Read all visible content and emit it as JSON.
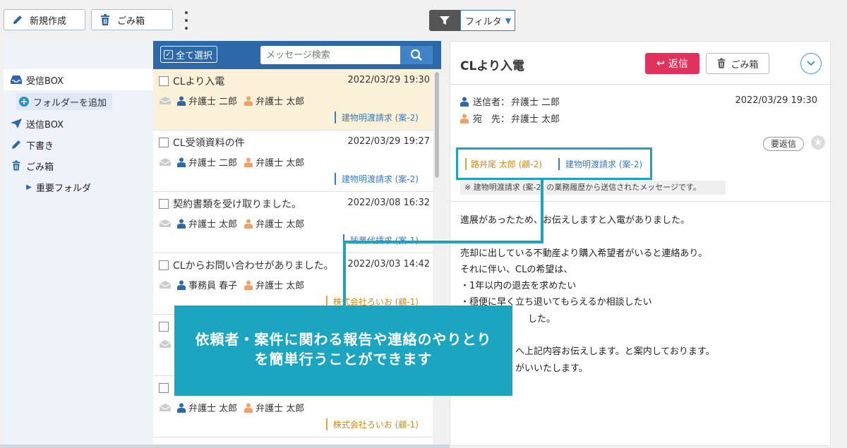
{
  "toolbar": {
    "new_label": "新規作成",
    "trash_label": "ごみ箱",
    "filter_label": "フィルタ"
  },
  "sidebar": {
    "items": [
      {
        "label": "受信BOX",
        "icon": "inbox-icon"
      },
      {
        "label": "フォルダーを追加",
        "icon": "plus-circle-icon"
      },
      {
        "label": "送信BOX",
        "icon": "send-icon"
      },
      {
        "label": "下書き",
        "icon": "pencil-icon"
      },
      {
        "label": "ごみ箱",
        "icon": "trash-icon"
      },
      {
        "label": "重要フォルダ",
        "icon": "caret-right-icon"
      }
    ]
  },
  "list": {
    "select_all_label": "全て選択",
    "search_placeholder": "メッセージ検索",
    "messages": [
      {
        "subject": "CLより入電",
        "date": "2022/03/29 19:30",
        "from": "弁護士 二郎",
        "to": "弁護士 太郎",
        "tag": "建物明渡請求 (案-2)",
        "tag_color": "blue",
        "selected": true
      },
      {
        "subject": "CL受領資料の件",
        "date": "2022/03/29 19:27",
        "from": "弁護士 二郎",
        "to": "弁護士 太郎",
        "tag": "建物明渡請求 (案-2)",
        "tag_color": "blue"
      },
      {
        "subject": "契約書類を受け取りました。",
        "date": "2022/03/08 16:32",
        "from": "弁護士 太郎",
        "to": "弁護士 太郎",
        "tag": "残業代請求 (案-1)",
        "tag_color": "blue"
      },
      {
        "subject": "CLからお問い合わせがありました。",
        "date": "2022/03/03 14:42",
        "from": "事務員 春子",
        "to": "弁護士 太郎",
        "tag": "株式会社ろいお (顧-1)",
        "tag_color": "orange"
      },
      {
        "subject": "",
        "date": "",
        "from": "",
        "to": "",
        "tag": "",
        "tag_color": "orange"
      },
      {
        "subject": "",
        "date": "",
        "from": "弁護士 太郎",
        "to": "弁護士 太郎",
        "tag": "株式会社ろいお (顧-1)",
        "tag_color": "orange"
      }
    ]
  },
  "detail": {
    "title": "CLより入電",
    "reply_label": "返信",
    "trash_label": "ごみ箱",
    "sender_label": "送信者：",
    "sender": "弁護士 二郎",
    "to_label": "宛　先：",
    "to": "弁護士 太郎",
    "date": "2022/03/29 19:30",
    "need_reply": "要返信",
    "tag1": "路井尾 太郎 (顧-2)",
    "tag2": "建物明渡請求 (案-2)",
    "note": "※ 建物明渡請求 (案-2) の業務履歴から送信されたメッセージです。",
    "body": [
      "進展があったため、お伝えしますと入電がありました。",
      "",
      "売却に出している不動産より購入希望者がいると連絡あり。",
      "それに伴い、CLの希望は、",
      "・1年以内の退去を求めたい",
      "・穏便に早く立ち退いてもらえるか相談したい",
      "した。",
      "",
      "へ上記内容お伝えします。と案内しております。",
      "がいいたします。"
    ]
  },
  "callout": {
    "line1": "依頼者・案件に関わる報告や連絡のやりとり",
    "line2": "を簡単行うことができます"
  },
  "colors": {
    "accent_blue": "#2d68a9",
    "reply_red": "#e0325d",
    "callout_teal": "#1ba5c0",
    "selected_row": "#fbf1d8"
  }
}
